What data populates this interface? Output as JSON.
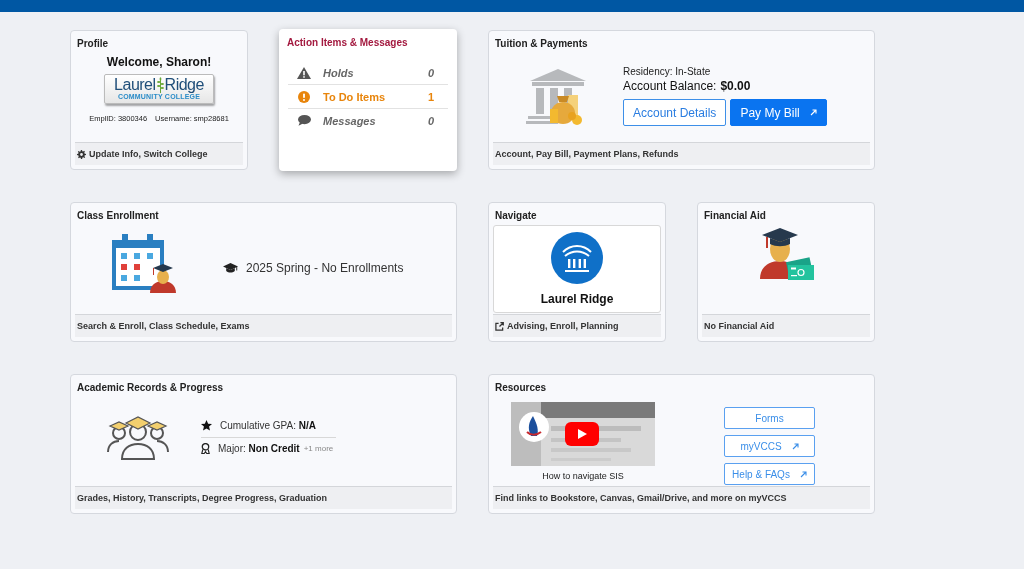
{
  "profile": {
    "title": "Profile",
    "welcome": "Welcome, Sharon!",
    "logo": {
      "word_1": "Laurel",
      "word_2": "Ridge",
      "subtitle": "COMMUNITY COLLEGE"
    },
    "emplid": "EmplID: 3800346",
    "username": "Username: smp28681",
    "footer": "Update Info, Switch College"
  },
  "action_items": {
    "title": "Action Items & Messages",
    "items": [
      {
        "kind": "warning",
        "label": "Holds",
        "count": "0",
        "highlighted": false
      },
      {
        "kind": "alert",
        "label": "To Do Items",
        "count": "1",
        "highlighted": true
      },
      {
        "kind": "message",
        "label": "Messages",
        "count": "0",
        "highlighted": false
      }
    ]
  },
  "tuition": {
    "title": "Tuition & Payments",
    "residency": "Residency: In-State",
    "balance_label": "Account Balance:",
    "balance": "$0.00",
    "buttons": [
      {
        "label": "Account Details",
        "kind": "outline",
        "external": false
      },
      {
        "label": "Pay My Bill",
        "kind": "primary",
        "external": true
      }
    ],
    "footer": "Account, Pay Bill, Payment Plans, Refunds"
  },
  "class_enrollment": {
    "title": "Class Enrollment",
    "term": "2025 Spring - No Enrollments",
    "footer": "Search & Enroll, Class Schedule, Exams"
  },
  "navigate": {
    "title": "Navigate",
    "name": "Laurel Ridge",
    "footer": "Advising, Enroll, Planning"
  },
  "financial_aid": {
    "title": "Financial Aid",
    "footer": "No Financial Aid"
  },
  "academic_records": {
    "title": "Academic Records & Progress",
    "gpa_label": "Cumulative GPA:",
    "gpa": "N/A",
    "major_label": "Major:",
    "major": "Non Credit",
    "more": "+1 more",
    "footer": "Grades, History, Transcripts, Degree Progress, Graduation"
  },
  "resources": {
    "title": "Resources",
    "video": {
      "caption": "How to navigate SIS"
    },
    "buttons": [
      {
        "label": "Forms",
        "external": false
      },
      {
        "label": "myVCCS",
        "external": true
      },
      {
        "label": "Help & FAQs",
        "external": true
      }
    ],
    "footer": "Find links to Bookstore, Canvas, Gmail/Drive, and more on myVCCS"
  }
}
